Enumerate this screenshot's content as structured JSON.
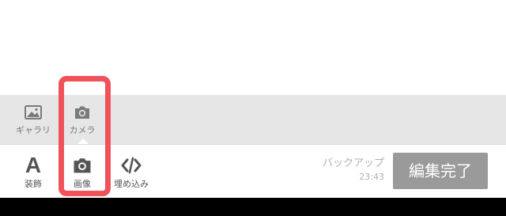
{
  "media_row": {
    "items": [
      {
        "label": "ギャラリ",
        "icon": "gallery-icon"
      },
      {
        "label": "カメラ",
        "icon": "camera-icon"
      }
    ]
  },
  "toolbar": {
    "items": [
      {
        "label": "装飾",
        "icon": "text-decoration-icon",
        "glyph": "A"
      },
      {
        "label": "画像",
        "icon": "camera-icon"
      },
      {
        "label": "埋め込み",
        "icon": "code-embed-icon"
      }
    ],
    "backup_label": "バックアップ",
    "backup_time": "23:43",
    "done_label": "編集完了"
  },
  "colors": {
    "accent_highlight": "#f0525a",
    "done_button": "#9a9a9a",
    "media_row_bg": "#e6e6e6"
  }
}
